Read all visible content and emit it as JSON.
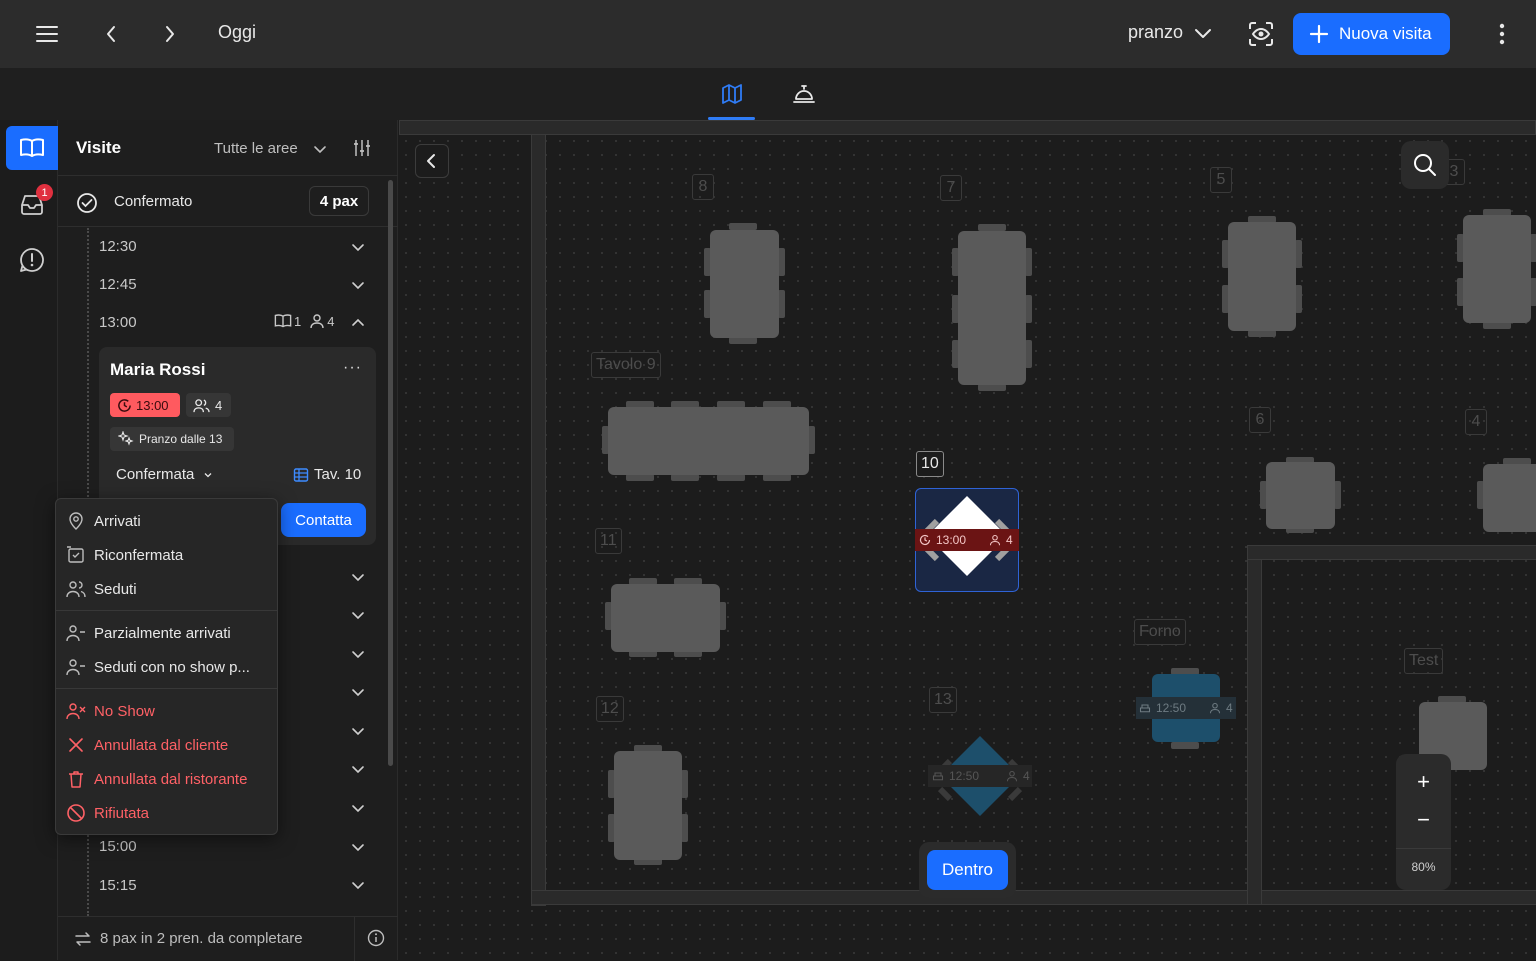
{
  "topbar": {
    "date_label": "Oggi",
    "shift": "pranzo",
    "new_visit_label": "Nuova visita"
  },
  "tabs": [
    {
      "icon": "map-icon",
      "active": true
    },
    {
      "icon": "service-bell-icon",
      "active": false
    }
  ],
  "rail": {
    "items": [
      {
        "icon": "book-icon",
        "active": true
      },
      {
        "icon": "inbox-icon",
        "badge": "1"
      },
      {
        "icon": "alert-bubble-icon"
      }
    ]
  },
  "panel": {
    "title": "Visite",
    "area_filter": "Tutte le aree",
    "status_group": "Confermato",
    "status_pax": "4 pax",
    "slots": [
      "12:30",
      "12:45",
      "13:00",
      "15:00",
      "15:15"
    ],
    "slot_1300_meta": {
      "bookings": "1",
      "pax": "4"
    },
    "footer_text": "8 pax in 2 pren. da completare"
  },
  "booking": {
    "name": "Maria Rossi",
    "time": "13:00",
    "people": "4",
    "tag": "Pranzo dalle 13",
    "status": "Confermata",
    "table": "Tav. 10",
    "contact_label": "Contatta",
    "more": "···"
  },
  "status_menu": {
    "group1": [
      "Arrivati",
      "Riconfermata",
      "Seduti"
    ],
    "group2": [
      "Parzialmente arrivati",
      "Seduti con no show p..."
    ],
    "group3": [
      "No Show",
      "Annullata dal cliente",
      "Annullata dal ristorante",
      "Rifiutata"
    ]
  },
  "floor": {
    "tables": [
      "8",
      "7",
      "5",
      "3",
      "Tavolo 9",
      "10",
      "6",
      "4",
      "11",
      "Forno",
      "Test",
      "12",
      "13"
    ],
    "table10_resv": {
      "time": "13:00",
      "people": "4"
    },
    "table13_resv": {
      "time": "12:50",
      "people": "4"
    },
    "forno_resv": {
      "time": "12:50",
      "people": "4"
    },
    "zoom": "80%",
    "zoom_in": "+",
    "zoom_out": "−",
    "inside_button": "Dentro"
  },
  "colors": {
    "accent": "#1a6dff",
    "danger": "#ff6166",
    "time_chip": "#ff5a5f",
    "selected_resv": "#6b1414",
    "seated_table": "#1d4f6b"
  }
}
